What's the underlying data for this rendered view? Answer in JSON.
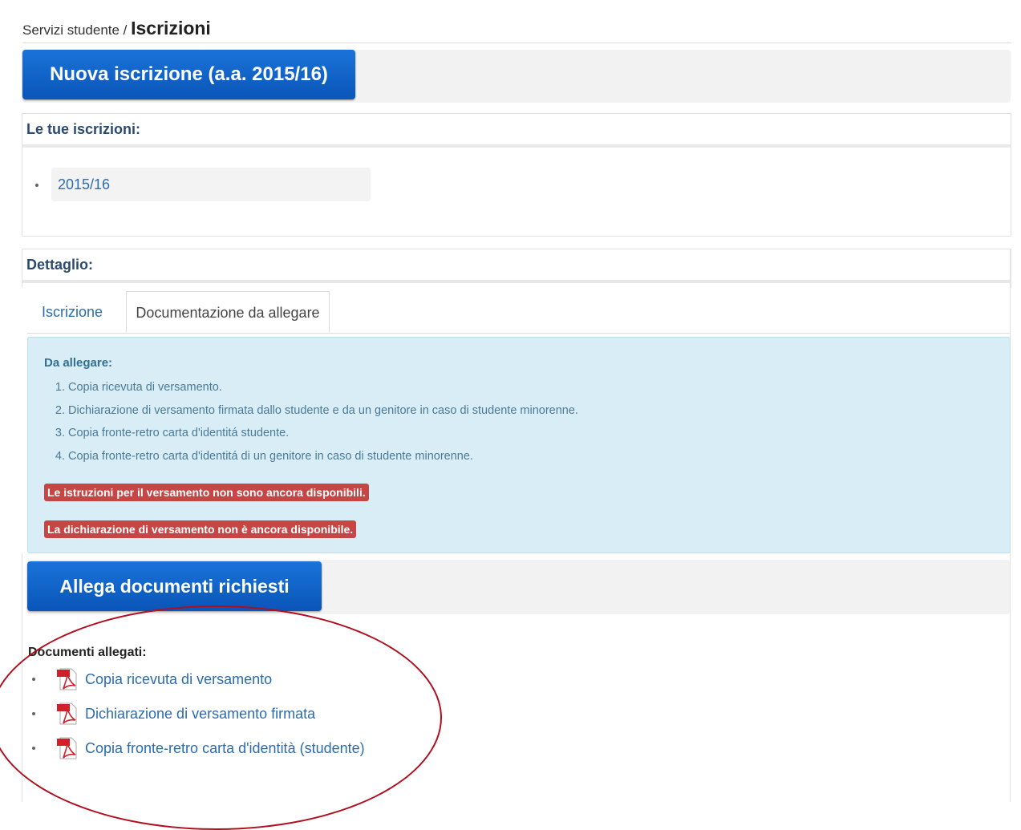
{
  "breadcrumb": {
    "parent": "Servizi studente",
    "separator": " / ",
    "current": "Iscrizioni"
  },
  "new_enrollment_button": "Nuova iscrizione (a.a. 2015/16)",
  "enrollments_panel": {
    "title": "Le tue iscrizioni:",
    "items": [
      "2015/16"
    ]
  },
  "detail_panel": {
    "title": "Dettaglio:",
    "tabs": [
      "Iscrizione",
      "Documentazione da allegare"
    ],
    "active_tab": "Documentazione da allegare"
  },
  "attach_info": {
    "title": "Da allegare:",
    "items": [
      "Copia ricevuta di versamento.",
      "Dichiarazione di versamento firmata dallo studente e da un genitore in caso di studente minorenne.",
      "Copia fronte-retro carta d'identitá studente.",
      "Copia fronte-retro carta d'identitá di un genitore in caso di studente minorenne."
    ],
    "warnings": [
      "Le istruzioni per il versamento non sono ancora disponibili.",
      "La dichiarazione di versamento non è ancora disponibile."
    ]
  },
  "attach_button": "Allega documenti richiesti",
  "attached_docs": {
    "title": "Documenti allegati:",
    "items": [
      "Copia ricevuta di versamento",
      "Dichiarazione di versamento firmata",
      "Copia fronte-retro carta d'identità (studente)"
    ],
    "icon": "pdf-icon"
  },
  "colors": {
    "primary": "#0a5fc4",
    "danger": "#c64545",
    "info_bg": "#d9edf7",
    "link": "#2a6cb0",
    "highlight_ellipse": "#b00f1e"
  }
}
